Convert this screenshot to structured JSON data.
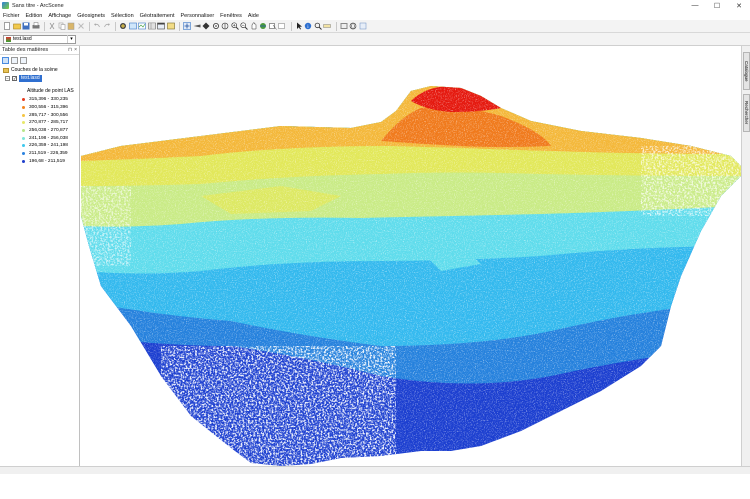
{
  "window": {
    "title": "Sans titre - ArcScene",
    "controls": {
      "minimize": "—",
      "maximize": "☐",
      "close": "✕"
    }
  },
  "menu": [
    "Fichier",
    "Edition",
    "Affichage",
    "Géosignets",
    "Sélection",
    "Géotraitement",
    "Personnaliser",
    "Fenêtres",
    "Aide"
  ],
  "toolbar": {
    "layer_select": "test.lasd"
  },
  "toc": {
    "title": "Table des matières",
    "pin": "⊓",
    "close": "×",
    "scene_layers": "Couches de la scène",
    "layer_name": "test.lasd",
    "legend_title": "Altitude de point LAS",
    "legend": [
      {
        "label": "315,396 - 330,235",
        "color": "#e53a1c"
      },
      {
        "label": "300,556 - 315,396",
        "color": "#f4841f"
      },
      {
        "label": "285,717 - 300,556",
        "color": "#f5c542"
      },
      {
        "label": "270,877 - 285,717",
        "color": "#e8e86a"
      },
      {
        "label": "256,038 - 270,877",
        "color": "#b9e58a"
      },
      {
        "label": "241,198 - 256,038",
        "color": "#7fe6d8"
      },
      {
        "label": "226,359 - 241,198",
        "color": "#3fc8ee"
      },
      {
        "label": "211,519 - 226,359",
        "color": "#2a82e0"
      },
      {
        "label": "196,68 - 211,519",
        "color": "#1f3fcc"
      }
    ]
  },
  "dock": {
    "tab_catalog": "Catalogue",
    "tab_search": "Rechercher"
  },
  "colors": {
    "band_red": "#e5190f",
    "band_orange": "#f07a1c",
    "band_yellow_orange": "#f4b83a",
    "band_yellow": "#e2e85a",
    "band_light_green": "#c9eb86",
    "band_aqua": "#5fdcec",
    "band_cyan": "#33b9ee",
    "band_blue": "#2581dd",
    "band_dark_blue": "#1c3fd0"
  }
}
